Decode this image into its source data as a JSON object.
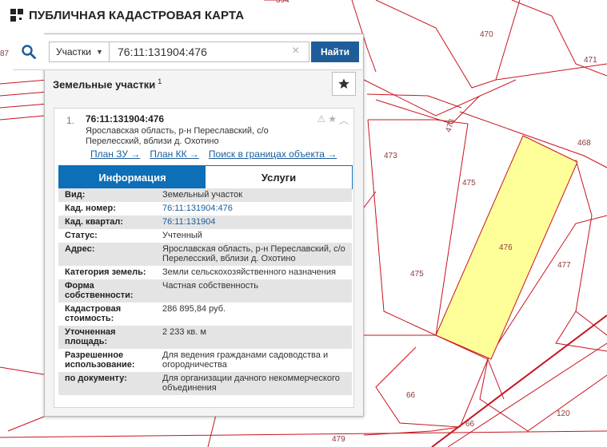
{
  "app": {
    "title": "ПУБЛИЧНАЯ КАДАСТРОВАЯ КАРТА"
  },
  "search": {
    "type_label": "Участки",
    "query": "76:11:131904:476",
    "button": "Найти"
  },
  "section": {
    "title": "Земельные участки",
    "count": "1"
  },
  "result": {
    "index": "1.",
    "cadastral_id": "76:11:131904:476",
    "address": "Ярославская область, р-н Переславский, с/о Перелесский, вблизи д. Охотино",
    "links": [
      "План ЗУ →",
      "План КК →",
      "Поиск в границах объекта →"
    ]
  },
  "tabs": [
    "Информация",
    "Услуги"
  ],
  "info_rows": [
    {
      "key": "Вид:",
      "value": "Земельный участок",
      "link": false
    },
    {
      "key": "Кад. номер:",
      "value": "76:11:131904:476",
      "link": true
    },
    {
      "key": "Кад. квартал:",
      "value": "76:11:131904",
      "link": true
    },
    {
      "key": "Статус:",
      "value": "Учтенный",
      "link": false
    },
    {
      "key": "Адрес:",
      "value": "Ярославская область, р-н Переславский, с/о Перелесский, вблизи д. Охотино",
      "link": false
    },
    {
      "key": "Категория земель:",
      "value": "Земли сельскохозяйственного назначения",
      "link": false
    },
    {
      "key": "Форма собственности:",
      "value": "Частная собственность",
      "link": false
    },
    {
      "key": "Кадастровая стоимость:",
      "value": "286 895,84 руб.",
      "link": false
    },
    {
      "key": "Уточненная площадь:",
      "value": "2 233 кв. м",
      "link": false
    },
    {
      "key": "Разрешенное использование:",
      "value": "Для ведения гражданами садоводства и огородничества",
      "link": false
    },
    {
      "key": "по документу:",
      "value": "Для организации дачного некоммерческого объединения",
      "link": false
    }
  ],
  "map_labels": [
    "394",
    "470",
    "471",
    "87",
    "473",
    "473",
    "468",
    "475",
    "476",
    "475",
    "477",
    "66",
    "66",
    "120",
    "479"
  ],
  "colors": {
    "accent": "#0d6fb8",
    "button": "#1d5d9a",
    "parcel_highlight": "#ffff99",
    "boundary": "#cc0000"
  }
}
